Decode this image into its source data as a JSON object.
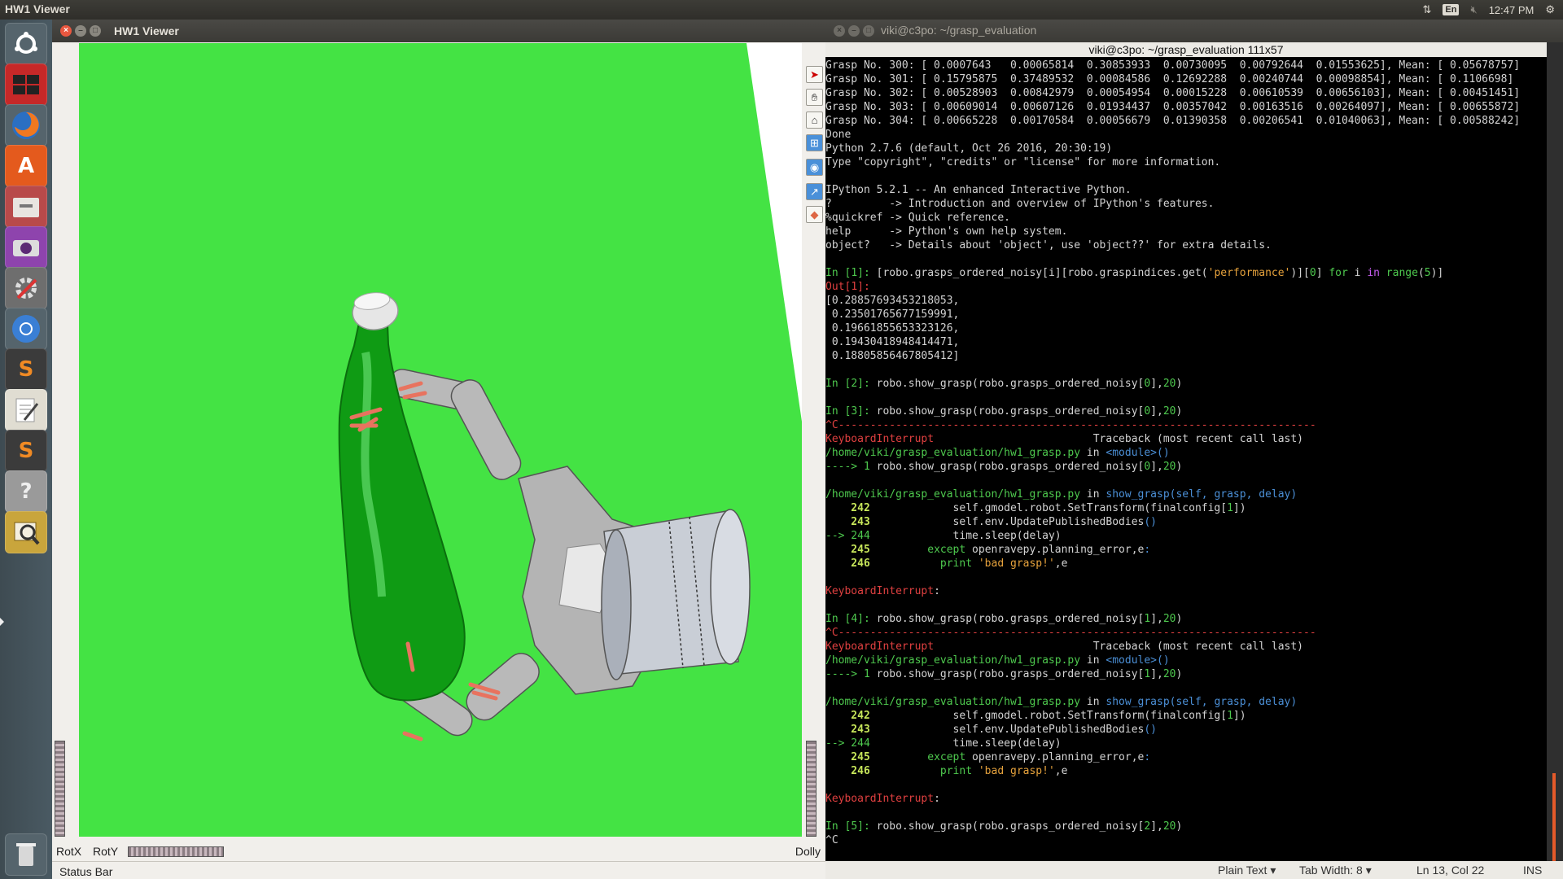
{
  "top_panel": {
    "window_title": "HW1 Viewer",
    "lang": "En",
    "clock": "12:47 PM",
    "icons": [
      "network-updown-icon",
      "keyboard-lang-icon",
      "volume-muted-icon",
      "settings-gear-icon"
    ]
  },
  "launcher": {
    "items": [
      {
        "name": "ubuntu-dash",
        "color": "#dcdcdc"
      },
      {
        "name": "workspace-switcher",
        "color": "#c62828"
      },
      {
        "name": "firefox",
        "color": "#e8671c"
      },
      {
        "name": "software-center",
        "color": "#e45a1d"
      },
      {
        "name": "files",
        "color": "#b84a4a"
      },
      {
        "name": "screenshot",
        "color": "#8e44ad"
      },
      {
        "name": "system-settings",
        "color": "#6e6e6e"
      },
      {
        "name": "chromium",
        "color": "#3a7fd5"
      },
      {
        "name": "sublime-text",
        "color": "#3b3b3b"
      },
      {
        "name": "text-editor",
        "color": "#e0ddd2"
      },
      {
        "name": "sublime-text-2",
        "color": "#3b3b3b"
      },
      {
        "name": "help",
        "color": "#9a9a9a"
      },
      {
        "name": "image-viewer",
        "color": "#c9a53c"
      },
      {
        "name": "trash",
        "color": "#d8d8d8"
      }
    ]
  },
  "viewer": {
    "title": "HW1 Viewer",
    "rotx": "RotX",
    "roty": "RotY",
    "dolly": "Dolly",
    "status": "Status Bar",
    "tools": [
      "select-arrow-icon",
      "hand-icon",
      "home-icon",
      "view-all-icon",
      "camera-icon",
      "seek-icon",
      "perspective-icon"
    ],
    "background_color": "#44e344"
  },
  "terminal": {
    "title": "viki@c3po: ~/grasp_evaluation",
    "header": "viki@c3po: ~/grasp_evaluation 111x57",
    "lines": [
      [
        {
          "t": "Grasp No. 300: [ 0.0007643   0.00065814  0.30853933  0.00730095  0.00792644  0.01553625], Mean: [ 0.05678757]"
        }
      ],
      [
        {
          "t": "Grasp No. 301: [ 0.15795875  0.37489532  0.00084586  0.12692288  0.00240744  0.00098854], Mean: [ 0.1106698]"
        }
      ],
      [
        {
          "t": "Grasp No. 302: [ 0.00528903  0.00842979  0.00054954  0.00015228  0.00610539  0.00656103], Mean: [ 0.00451451]"
        }
      ],
      [
        {
          "t": "Grasp No. 303: [ 0.00609014  0.00607126  0.01934437  0.00357042  0.00163516  0.00264097], Mean: [ 0.00655872]"
        }
      ],
      [
        {
          "t": "Grasp No. 304: [ 0.00665228  0.00170584  0.00056679  0.01390358  0.00206541  0.01040063], Mean: [ 0.00588242]"
        }
      ],
      [
        {
          "t": "Done"
        }
      ],
      [
        {
          "t": "Python 2.7.6 (default, Oct 26 2016, 20:30:19)"
        }
      ],
      [
        {
          "t": "Type \"copyright\", \"credits\" or \"license\" for more information."
        }
      ],
      [
        {
          "t": ""
        }
      ],
      [
        {
          "t": "IPython 5.2.1 -- An enhanced Interactive Python."
        }
      ],
      [
        {
          "t": "?         -> Introduction and overview of IPython's features."
        }
      ],
      [
        {
          "t": "%quickref -> Quick reference."
        }
      ],
      [
        {
          "t": "help      -> Python's own help system."
        }
      ],
      [
        {
          "t": "object?   -> Details about 'object', use 'object??' for extra details."
        }
      ],
      [
        {
          "t": ""
        }
      ],
      [
        {
          "t": "In [",
          "c": "green"
        },
        {
          "t": "1",
          "c": "green"
        },
        {
          "t": "]: ",
          "c": "green"
        },
        {
          "t": "[robo.grasps_ordered_noisy[i][robo.graspindices.get("
        },
        {
          "t": "'performance'",
          "c": "orange"
        },
        {
          "t": ")]["
        },
        {
          "t": "0",
          "c": "green"
        },
        {
          "t": "] "
        },
        {
          "t": "for",
          "c": "green"
        },
        {
          "t": " i "
        },
        {
          "t": "in",
          "c": "purple"
        },
        {
          "t": " "
        },
        {
          "t": "range",
          "c": "green"
        },
        {
          "t": "("
        },
        {
          "t": "5",
          "c": "green"
        },
        {
          "t": ")]"
        }
      ],
      [
        {
          "t": "Out[",
          "c": "red"
        },
        {
          "t": "1",
          "c": "red"
        },
        {
          "t": "]:",
          "c": "red"
        }
      ],
      [
        {
          "t": "[0.28857693453218053,"
        }
      ],
      [
        {
          "t": " 0.23501765677159991,"
        }
      ],
      [
        {
          "t": " 0.19661855653323126,"
        }
      ],
      [
        {
          "t": " 0.19430418948414471,"
        }
      ],
      [
        {
          "t": " 0.18805856467805412]"
        }
      ],
      [
        {
          "t": ""
        }
      ],
      [
        {
          "t": "In [",
          "c": "green"
        },
        {
          "t": "2",
          "c": "green"
        },
        {
          "t": "]: ",
          "c": "green"
        },
        {
          "t": "robo.show_grasp(robo.grasps_ordered_noisy["
        },
        {
          "t": "0",
          "c": "green"
        },
        {
          "t": "],"
        },
        {
          "t": "20",
          "c": "green"
        },
        {
          "t": ")"
        }
      ],
      [
        {
          "t": ""
        }
      ],
      [
        {
          "t": "In [",
          "c": "green"
        },
        {
          "t": "3",
          "c": "green"
        },
        {
          "t": "]: ",
          "c": "green"
        },
        {
          "t": "robo.show_grasp(robo.grasps_ordered_noisy["
        },
        {
          "t": "0",
          "c": "green"
        },
        {
          "t": "],"
        },
        {
          "t": "20",
          "c": "green"
        },
        {
          "t": ")"
        }
      ],
      [
        {
          "t": "^C---------------------------------------------------------------------------",
          "c": "red"
        }
      ],
      [
        {
          "t": "KeyboardInterrupt",
          "c": "red"
        },
        {
          "t": "                         Traceback (most recent call last)"
        }
      ],
      [
        {
          "t": "/home/viki/grasp_evaluation/hw1_grasp.py",
          "c": "green"
        },
        {
          "t": " in "
        },
        {
          "t": "<module>()",
          "c": "blue"
        }
      ],
      [
        {
          "t": "----> 1 ",
          "c": "green"
        },
        {
          "t": "robo.show_grasp(robo.grasps_ordered_noisy["
        },
        {
          "t": "0",
          "c": "green"
        },
        {
          "t": "],"
        },
        {
          "t": "20",
          "c": "green"
        },
        {
          "t": ")"
        }
      ],
      [
        {
          "t": ""
        }
      ],
      [
        {
          "t": "/home/viki/grasp_evaluation/hw1_grasp.py",
          "c": "green"
        },
        {
          "t": " in "
        },
        {
          "t": "show_grasp(self, grasp, delay)",
          "c": "blue"
        }
      ],
      [
        {
          "t": "    242",
          "c": "num"
        },
        {
          "t": "             self.gmodel.robot.SetTransform(finalconfig["
        },
        {
          "t": "1",
          "c": "green"
        },
        {
          "t": "])"
        }
      ],
      [
        {
          "t": "    243",
          "c": "num"
        },
        {
          "t": "             self.env.UpdatePublishedBodies"
        },
        {
          "t": "()",
          "c": "blue"
        }
      ],
      [
        {
          "t": "--> 244",
          "c": "green"
        },
        {
          "t": "             time.sleep(delay)"
        }
      ],
      [
        {
          "t": "    245",
          "c": "num"
        },
        {
          "t": "         "
        },
        {
          "t": "except",
          "c": "green"
        },
        {
          "t": " openravepy.planning_error,e"
        },
        {
          "t": ":",
          "c": "blue"
        }
      ],
      [
        {
          "t": "    246",
          "c": "num"
        },
        {
          "t": "           "
        },
        {
          "t": "print",
          "c": "green"
        },
        {
          "t": " "
        },
        {
          "t": "'bad grasp!'",
          "c": "orange"
        },
        {
          "t": ",e"
        }
      ],
      [
        {
          "t": ""
        }
      ],
      [
        {
          "t": "KeyboardInterrupt",
          "c": "red"
        },
        {
          "t": ":"
        }
      ],
      [
        {
          "t": ""
        }
      ],
      [
        {
          "t": "In [",
          "c": "green"
        },
        {
          "t": "4",
          "c": "green"
        },
        {
          "t": "]: ",
          "c": "green"
        },
        {
          "t": "robo.show_grasp(robo.grasps_ordered_noisy["
        },
        {
          "t": "1",
          "c": "green"
        },
        {
          "t": "],"
        },
        {
          "t": "20",
          "c": "green"
        },
        {
          "t": ")"
        }
      ],
      [
        {
          "t": "^C---------------------------------------------------------------------------",
          "c": "red"
        }
      ],
      [
        {
          "t": "KeyboardInterrupt",
          "c": "red"
        },
        {
          "t": "                         Traceback (most recent call last)"
        }
      ],
      [
        {
          "t": "/home/viki/grasp_evaluation/hw1_grasp.py",
          "c": "green"
        },
        {
          "t": " in "
        },
        {
          "t": "<module>()",
          "c": "blue"
        }
      ],
      [
        {
          "t": "----> 1 ",
          "c": "green"
        },
        {
          "t": "robo.show_grasp(robo.grasps_ordered_noisy["
        },
        {
          "t": "1",
          "c": "green"
        },
        {
          "t": "],"
        },
        {
          "t": "20",
          "c": "green"
        },
        {
          "t": ")"
        }
      ],
      [
        {
          "t": ""
        }
      ],
      [
        {
          "t": "/home/viki/grasp_evaluation/hw1_grasp.py",
          "c": "green"
        },
        {
          "t": " in "
        },
        {
          "t": "show_grasp(self, grasp, delay)",
          "c": "blue"
        }
      ],
      [
        {
          "t": "    242",
          "c": "num"
        },
        {
          "t": "             self.gmodel.robot.SetTransform(finalconfig["
        },
        {
          "t": "1",
          "c": "green"
        },
        {
          "t": "])"
        }
      ],
      [
        {
          "t": "    243",
          "c": "num"
        },
        {
          "t": "             self.env.UpdatePublishedBodies"
        },
        {
          "t": "()",
          "c": "blue"
        }
      ],
      [
        {
          "t": "--> 244",
          "c": "green"
        },
        {
          "t": "             time.sleep(delay)"
        }
      ],
      [
        {
          "t": "    245",
          "c": "num"
        },
        {
          "t": "         "
        },
        {
          "t": "except",
          "c": "green"
        },
        {
          "t": " openravepy.planning_error,e"
        },
        {
          "t": ":",
          "c": "blue"
        }
      ],
      [
        {
          "t": "    246",
          "c": "num"
        },
        {
          "t": "           "
        },
        {
          "t": "print",
          "c": "green"
        },
        {
          "t": " "
        },
        {
          "t": "'bad grasp!'",
          "c": "orange"
        },
        {
          "t": ",e"
        }
      ],
      [
        {
          "t": ""
        }
      ],
      [
        {
          "t": "KeyboardInterrupt",
          "c": "red"
        },
        {
          "t": ":"
        }
      ],
      [
        {
          "t": ""
        }
      ],
      [
        {
          "t": "In [",
          "c": "green"
        },
        {
          "t": "5",
          "c": "green"
        },
        {
          "t": "]: ",
          "c": "green"
        },
        {
          "t": "robo.show_grasp(robo.grasps_ordered_noisy["
        },
        {
          "t": "2",
          "c": "green"
        },
        {
          "t": "],"
        },
        {
          "t": "20",
          "c": "green"
        },
        {
          "t": ")"
        }
      ],
      [
        {
          "t": "^C"
        }
      ]
    ]
  },
  "editor_status": {
    "syntax": "Plain Text",
    "tab_width": "Tab Width: 8",
    "position": "Ln 13, Col 22",
    "mode": "INS"
  }
}
